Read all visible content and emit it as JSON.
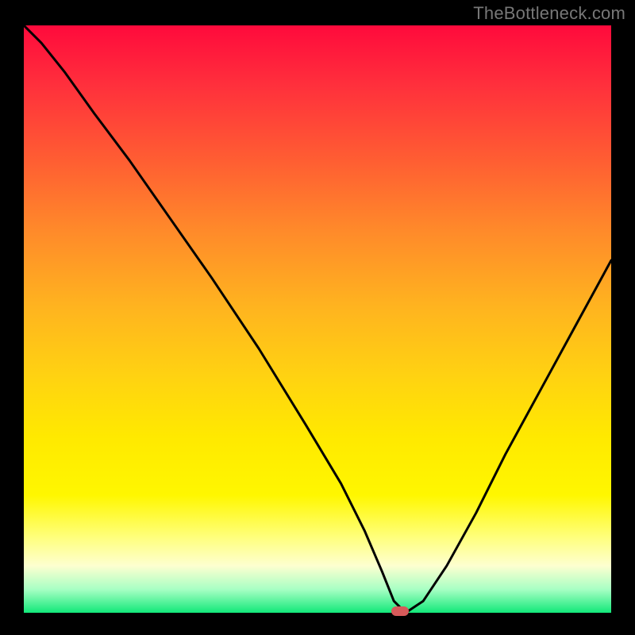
{
  "attribution": "TheBottleneck.com",
  "colors": {
    "frame_bg": "#000000",
    "curve": "#000000",
    "marker": "#d65a5a",
    "gradient_stops": [
      "#ff0a3c",
      "#ff2f3c",
      "#ff5a33",
      "#ff8a2a",
      "#ffb41f",
      "#ffd311",
      "#ffe900",
      "#fff700",
      "#ffff7a",
      "#fdffd0",
      "#a8ffc4",
      "#12e879"
    ]
  },
  "chart_data": {
    "type": "line",
    "title": "",
    "xlabel": "",
    "ylabel": "",
    "xlim": [
      0,
      100
    ],
    "ylim": [
      0,
      100
    ],
    "grid": false,
    "legend": false,
    "x": [
      0,
      3,
      7,
      12,
      18,
      25,
      32,
      40,
      48,
      54,
      58,
      61,
      63,
      65,
      68,
      72,
      77,
      82,
      88,
      94,
      100
    ],
    "values": [
      100,
      97,
      92,
      85,
      77,
      67,
      57,
      45,
      32,
      22,
      14,
      7,
      2,
      0,
      2,
      8,
      17,
      27,
      38,
      49,
      60
    ],
    "marker": {
      "x": 64,
      "y": 0
    }
  }
}
